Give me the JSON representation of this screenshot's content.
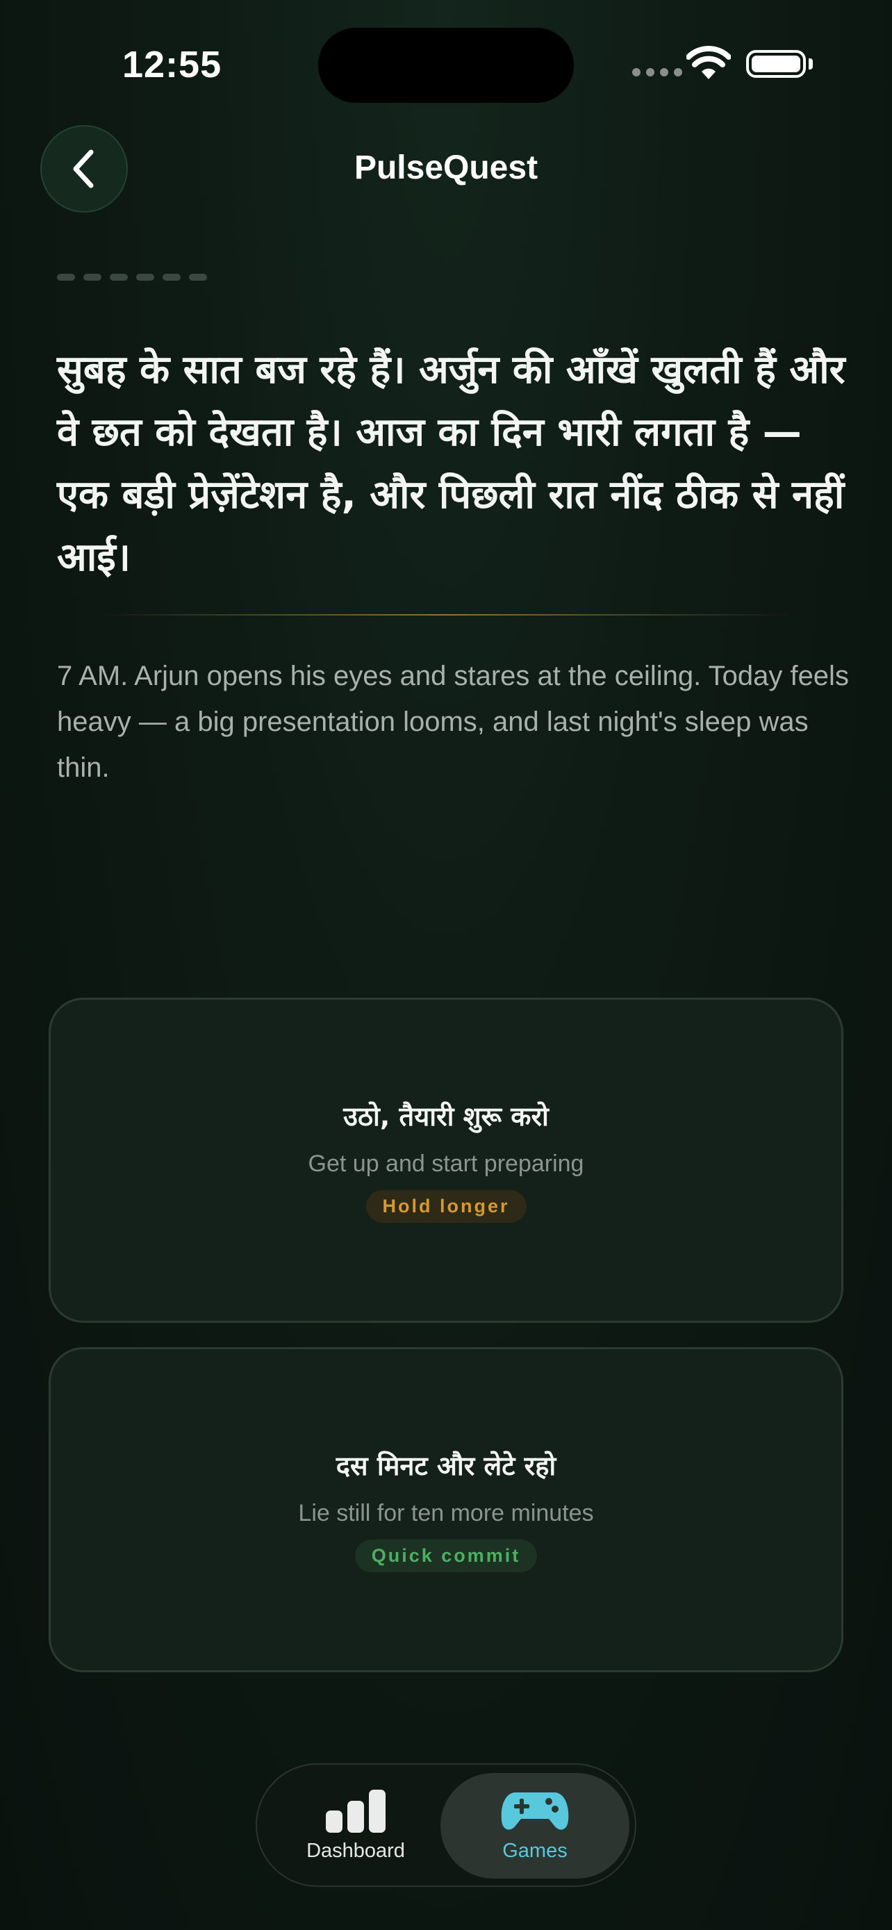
{
  "status_bar": {
    "time": "12:55"
  },
  "header": {
    "title": "PulseQuest",
    "back_icon": "chevron-left-icon"
  },
  "story": {
    "progress_steps": 6,
    "text_hindi": "सुबह के सात बज रहे हैं। अर्जुन की आँखें खुलती हैं और वे छत को देखता है। आज का दिन भारी लगता है — एक बड़ी प्रेज़ेंटेशन है, और पिछली रात नींद ठीक से नहीं आई।",
    "text_english": "7 AM. Arjun opens his eyes and stares at the ceiling. Today feels heavy — a big presentation looms, and last night's sleep was thin."
  },
  "choices": [
    {
      "title": "उठो, तैयारी शुरू करो",
      "subtitle": "Get up and start preparing",
      "tag": "Hold longer",
      "tag_color": "#d79a2e"
    },
    {
      "title": "दस मिनट और लेटे रहो",
      "subtitle": "Lie still for ten more minutes",
      "tag": "Quick commit",
      "tag_color": "#4caf64"
    }
  ],
  "tab_bar": {
    "items": [
      {
        "label": "Dashboard",
        "icon": "bar-chart-icon",
        "active": false
      },
      {
        "label": "Games",
        "icon": "gamepad-icon",
        "active": true
      }
    ],
    "active_color": "#58c9dc"
  }
}
